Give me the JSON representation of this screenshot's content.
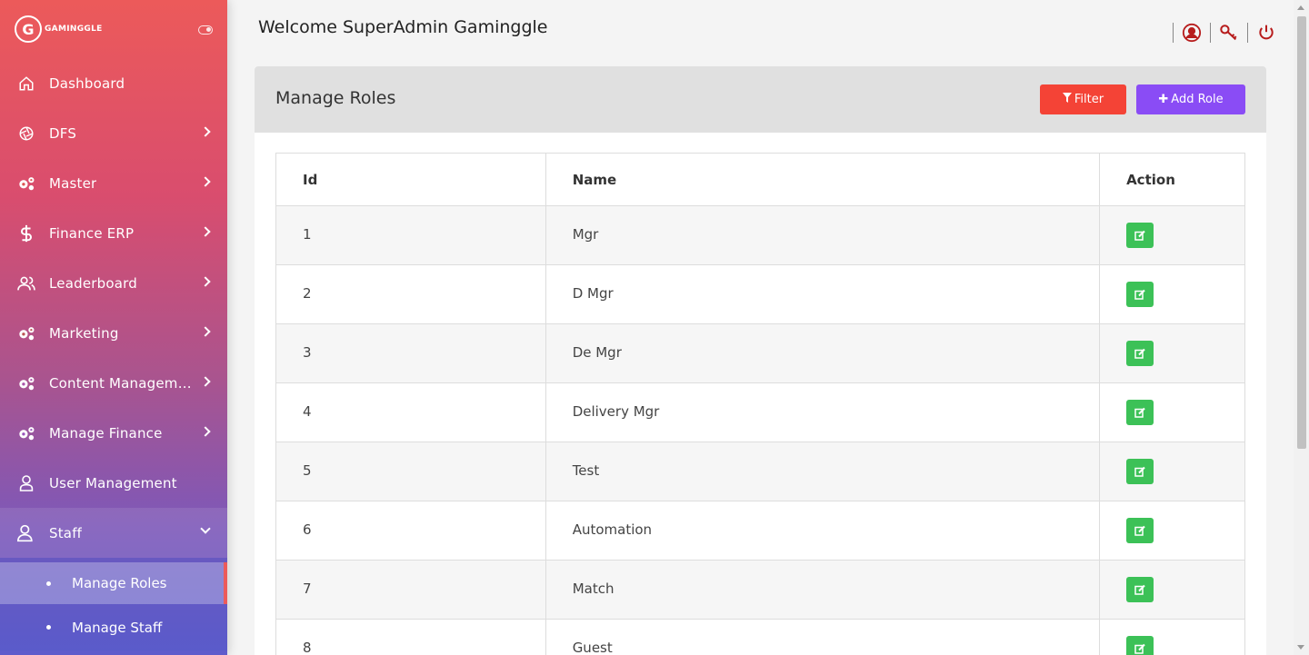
{
  "brand": {
    "logo_letter": "G",
    "name": "GAMINGGLE"
  },
  "sidebar": {
    "items": [
      {
        "label": "Dashboard",
        "icon": "home-icon"
      },
      {
        "label": "DFS",
        "icon": "aperture-icon"
      },
      {
        "label": "Master",
        "icon": "gears-icon"
      },
      {
        "label": "Finance ERP",
        "icon": "dollar-icon"
      },
      {
        "label": "Leaderboard",
        "icon": "users-icon"
      },
      {
        "label": "Marketing",
        "icon": "gears-icon"
      },
      {
        "label": "Content Management",
        "icon": "gears-icon"
      },
      {
        "label": "Manage Finance",
        "icon": "gears-icon"
      },
      {
        "label": "User Management",
        "icon": "user-icon"
      },
      {
        "label": "Staff",
        "icon": "user-icon"
      }
    ],
    "submenu": [
      {
        "label": "Manage Roles",
        "active": true
      },
      {
        "label": "Manage Staff",
        "active": false
      }
    ]
  },
  "header": {
    "welcome": "Welcome SuperAdmin Gaminggle"
  },
  "panel": {
    "title": "Manage Roles",
    "filter_label": "Filter",
    "add_label": "Add Role"
  },
  "table": {
    "columns": [
      "Id",
      "Name",
      "Action"
    ],
    "rows": [
      {
        "id": "1",
        "name": "Mgr"
      },
      {
        "id": "2",
        "name": "D Mgr"
      },
      {
        "id": "3",
        "name": "De Mgr"
      },
      {
        "id": "4",
        "name": "Delivery Mgr"
      },
      {
        "id": "5",
        "name": "Test"
      },
      {
        "id": "6",
        "name": "Automation"
      },
      {
        "id": "7",
        "name": "Match"
      },
      {
        "id": "8",
        "name": "Guest"
      }
    ]
  },
  "colors": {
    "filter": "#f44336",
    "add": "#8a4cf5",
    "edit": "#3cc157",
    "icon_red": "#b71c1c"
  }
}
